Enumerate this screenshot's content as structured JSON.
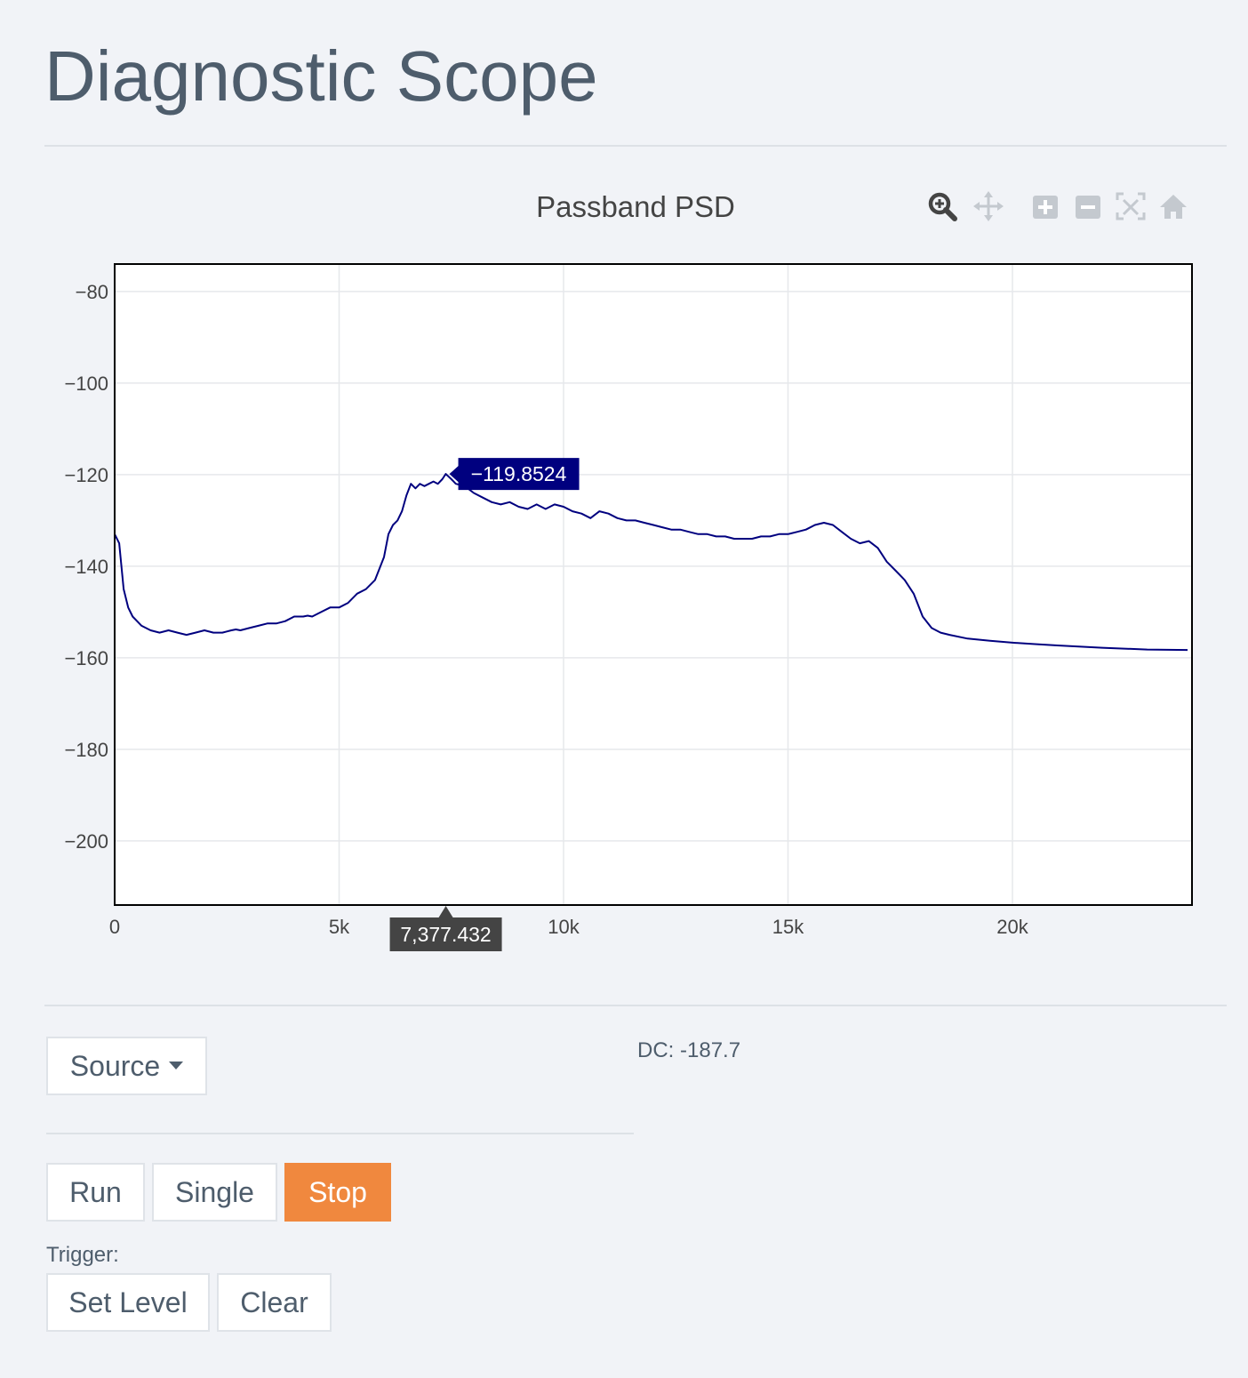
{
  "page": {
    "title": "Diagnostic Scope"
  },
  "modebar": {
    "icons": [
      "zoom-icon",
      "pan-icon",
      "zoom-in-icon",
      "zoom-out-icon",
      "autoscale-icon",
      "reset-axes-icon"
    ],
    "active_color": "#444444",
    "inactive_color": "#c4c9cf"
  },
  "controls": {
    "source_label": "Source",
    "dc_readout": "DC: -187.7",
    "run_label": "Run",
    "single_label": "Single",
    "stop_label": "Stop",
    "trigger_label": "Trigger:",
    "set_level_label": "Set Level",
    "clear_label": "Clear"
  },
  "colors": {
    "background": "#f1f3f7",
    "trace": "#00007f",
    "accent": "#f0883e",
    "text": "#4e5d6c",
    "hover_x_bg": "#444444",
    "hover_y_bg": "#00007f"
  },
  "chart_data": {
    "type": "line",
    "title": "Passband PSD",
    "xlabel": "",
    "ylabel": "",
    "xlim": [
      0,
      24000
    ],
    "ylim": [
      -214,
      -74
    ],
    "xticks": [
      0,
      5000,
      10000,
      15000,
      20000
    ],
    "xtick_labels": [
      "0",
      "5k",
      "10k",
      "15k",
      "20k"
    ],
    "yticks": [
      -80,
      -100,
      -120,
      -140,
      -160,
      -180,
      -200
    ],
    "ytick_labels": [
      "−80",
      "−100",
      "−120",
      "−140",
      "−160",
      "−180",
      "−200"
    ],
    "grid": true,
    "series": [
      {
        "color": "#00007f",
        "x": [
          0,
          100,
          200,
          300,
          400,
          600,
          800,
          1000,
          1200,
          1400,
          1600,
          1800,
          2000,
          2200,
          2400,
          2600,
          2700,
          2800,
          3000,
          3200,
          3400,
          3600,
          3800,
          4000,
          4200,
          4300,
          4400,
          4600,
          4800,
          5000,
          5200,
          5400,
          5600,
          5800,
          6000,
          6100,
          6200,
          6300,
          6400,
          6500,
          6600,
          6700,
          6800,
          6900,
          7000,
          7100,
          7200,
          7300,
          7377,
          7500,
          7600,
          7800,
          8000,
          8200,
          8400,
          8600,
          8800,
          9000,
          9200,
          9400,
          9600,
          9800,
          10000,
          10200,
          10400,
          10600,
          10800,
          11000,
          11200,
          11400,
          11600,
          11800,
          12000,
          12200,
          12400,
          12600,
          12800,
          13000,
          13200,
          13400,
          13600,
          13800,
          14000,
          14200,
          14400,
          14600,
          14800,
          15000,
          15200,
          15400,
          15600,
          15800,
          16000,
          16200,
          16400,
          16600,
          16800,
          17000,
          17200,
          17400,
          17600,
          17800,
          18000,
          18200,
          18400,
          18600,
          19000,
          19500,
          20000,
          20500,
          21000,
          22000,
          23000,
          23900
        ],
        "y": [
          -133,
          -135,
          -145,
          -149,
          -151,
          -153,
          -154,
          -154.5,
          -154,
          -154.5,
          -155,
          -154.5,
          -154,
          -154.5,
          -154.5,
          -154,
          -153.8,
          -154,
          -153.5,
          -153,
          -152.5,
          -152.5,
          -152,
          -151,
          -151,
          -150.8,
          -151,
          -150,
          -149,
          -149,
          -148,
          -146,
          -145,
          -143,
          -138,
          -133,
          -131,
          -130,
          -128,
          -124.5,
          -122,
          -123,
          -122,
          -122.5,
          -122,
          -121.5,
          -122,
          -121,
          -119.85,
          -121,
          -122,
          -122.5,
          -124,
          -125,
          -126,
          -126.5,
          -126,
          -127,
          -127.5,
          -126.5,
          -127.5,
          -126.5,
          -127,
          -128,
          -128.5,
          -129.5,
          -128,
          -128.5,
          -129.5,
          -130,
          -130,
          -130.5,
          -131,
          -131.5,
          -132,
          -132,
          -132.5,
          -133,
          -133,
          -133.5,
          -133.5,
          -134,
          -134,
          -134,
          -133.5,
          -133.5,
          -133,
          -133,
          -132.5,
          -132,
          -131,
          -130.5,
          -131,
          -132.5,
          -134,
          -135,
          -134.5,
          -136,
          -139,
          -141,
          -143,
          -146,
          -151,
          -153.5,
          -154.5,
          -155,
          -155.8,
          -156.3,
          -156.7,
          -157,
          -157.3,
          -157.8,
          -158.2,
          -158.3
        ]
      }
    ],
    "hover": {
      "x": 7377.432,
      "y": -119.8524,
      "x_label": "7,377.432",
      "y_label": "−119.8524"
    }
  }
}
